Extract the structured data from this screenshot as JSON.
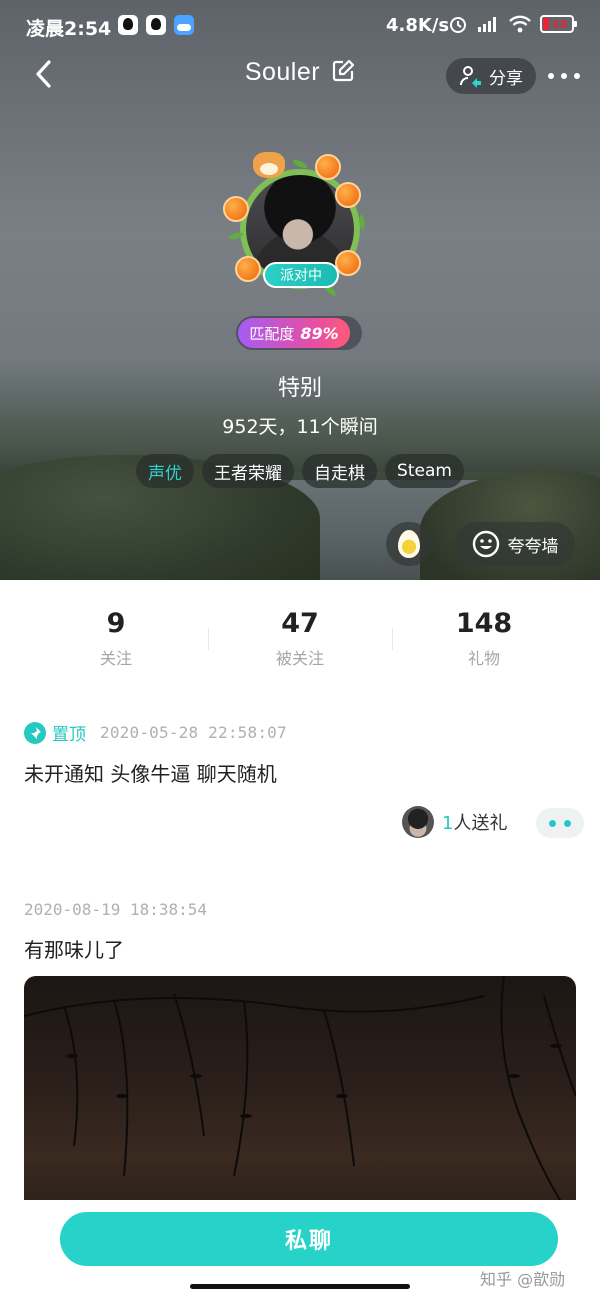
{
  "status_bar": {
    "time": "凌晨2:54",
    "network_speed": "4.8K/s",
    "battery": "15",
    "app_icons": [
      "qq-icon",
      "qq-icon",
      "weather-icon"
    ],
    "sys_icons": [
      "alarm-icon",
      "hd-signal-icon",
      "wifi-icon",
      "battery-icon"
    ]
  },
  "nav": {
    "title": "Souler",
    "share_label": "分享"
  },
  "profile": {
    "party_badge": "派对中",
    "match_label": "匹配度",
    "match_value": "89%",
    "nickname": "特别",
    "days_line": "952天，11个瞬间",
    "tags": [
      "声优",
      "王者荣耀",
      "自走棋",
      "Steam"
    ],
    "praise_label": "夸夸墙"
  },
  "stats": {
    "following": {
      "value": "9",
      "label": "关注"
    },
    "followers": {
      "value": "47",
      "label": "被关注"
    },
    "gifts": {
      "value": "148",
      "label": "礼物"
    }
  },
  "posts": [
    {
      "pinned_label": "置顶",
      "timestamp": "2020-05-28 22:58:07",
      "text": "未开通知 头像牛逼 聊天随机",
      "gift_count": "1",
      "gift_suffix": "人送礼"
    },
    {
      "timestamp": "2020-08-19 18:38:54",
      "text": "有那味儿了"
    }
  ],
  "bottom": {
    "chat_label": "私聊",
    "watermark": "知乎 @歆勋"
  },
  "colors": {
    "accent": "#27d3c8",
    "match_gradient_start": "#a55cf2",
    "match_gradient_end": "#ff5a7a",
    "battery_low": "#e23333"
  }
}
